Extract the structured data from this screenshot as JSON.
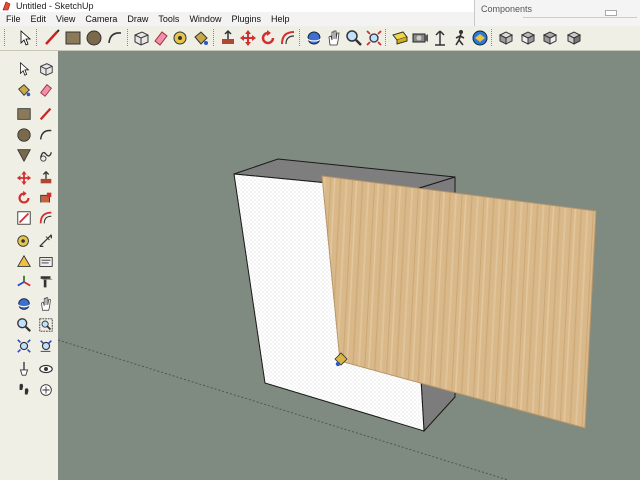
{
  "window": {
    "title": "Untitled - SketchUp"
  },
  "menu": [
    "File",
    "Edit",
    "View",
    "Camera",
    "Draw",
    "Tools",
    "Window",
    "Plugins",
    "Help"
  ],
  "components_panel": {
    "title": "Components"
  },
  "colors": {
    "canvas": "#7f8a80",
    "toolbar": "#f0efe6",
    "wood": "#d9b88a",
    "box_face": "#ffffff",
    "box_top": "#8b8b8b"
  },
  "toolbar_tools": [
    "select-icon",
    "line-icon",
    "rectangle-icon",
    "circle-icon",
    "arc-icon",
    "make-component-icon",
    "eraser-icon",
    "tape-measure-icon",
    "paint-bucket-icon",
    "push-pull-icon",
    "move-icon",
    "rotate-icon",
    "offset-icon",
    "orbit-icon",
    "pan-icon",
    "zoom-icon",
    "zoom-extents-icon",
    "previous-view-icon",
    "next-view-icon",
    "position-camera-icon",
    "look-around-icon",
    "walk-icon",
    "iso-view-icon",
    "top-view-icon",
    "front-view-icon"
  ],
  "left_tools": [
    "select-icon",
    "make-component-icon",
    "paint-bucket-icon",
    "eraser-icon",
    "rectangle-icon",
    "line-icon",
    "circle-icon",
    "arc-icon",
    "polygon-icon",
    "freehand-icon",
    "move-icon",
    "push-pull-icon",
    "rotate-icon",
    "follow-me-icon",
    "scale-icon",
    "offset-icon",
    "tape-measure-icon",
    "dimension-icon",
    "protractor-icon",
    "text-icon",
    "axes-icon",
    "3d-text-icon",
    "orbit-icon",
    "pan-icon",
    "zoom-icon",
    "zoom-window-icon",
    "zoom-extents-icon",
    "previous-view-icon",
    "position-camera-icon",
    "look-around-icon",
    "walk-icon",
    "section-plane-icon"
  ]
}
